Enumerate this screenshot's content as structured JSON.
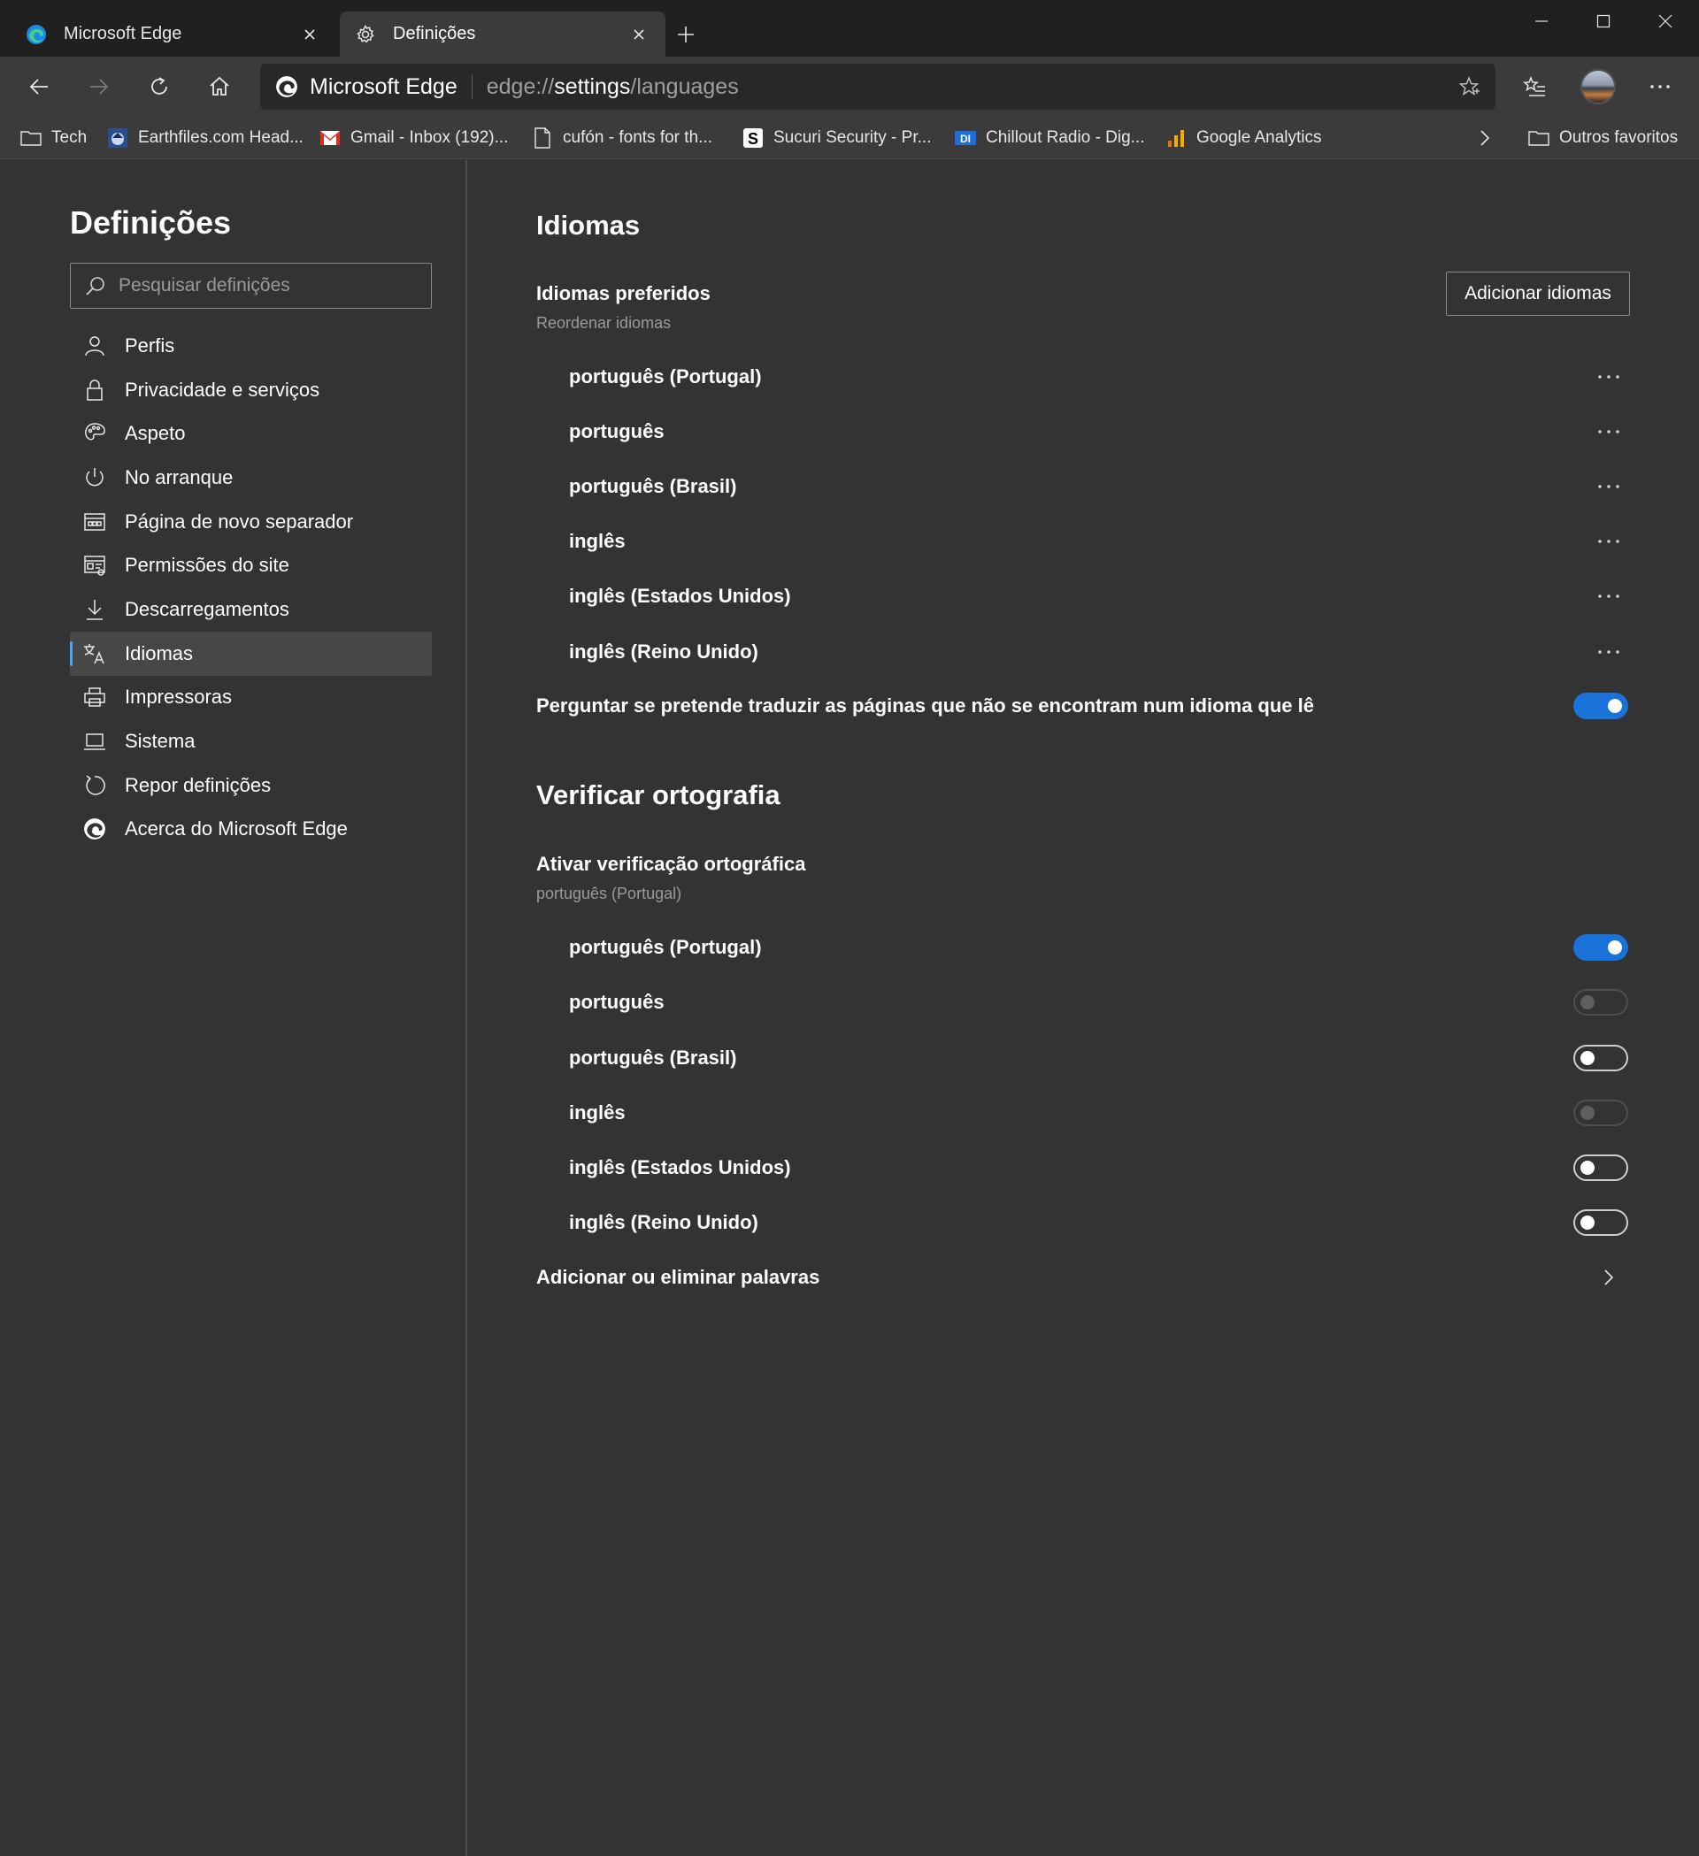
{
  "tabs": [
    {
      "label": "Microsoft Edge",
      "active": false
    },
    {
      "label": "Definições",
      "active": true
    }
  ],
  "address": {
    "site": "Microsoft Edge",
    "url_prefix": "edge://",
    "url_host": "settings",
    "url_path": "/languages"
  },
  "bookmarks": [
    {
      "label": "Tech",
      "icon": "folder-icon"
    },
    {
      "label": "Earthfiles.com Head...",
      "icon": "earthfiles-favicon"
    },
    {
      "label": "Gmail - Inbox (192)...",
      "icon": "gmail-favicon"
    },
    {
      "label": "cufón - fonts for th...",
      "icon": "page-icon"
    },
    {
      "label": "Sucuri Security - Pr...",
      "icon": "sucuri-favicon"
    },
    {
      "label": "Chillout Radio - Dig...",
      "icon": "di-favicon"
    },
    {
      "label": "Google Analytics",
      "icon": "analytics-favicon"
    },
    {
      "label": "Outros favoritos",
      "icon": "folder-icon"
    }
  ],
  "sidebar": {
    "title": "Definições",
    "search_placeholder": "Pesquisar definições",
    "items": [
      {
        "label": "Perfis",
        "icon": "person-icon"
      },
      {
        "label": "Privacidade e serviços",
        "icon": "lock-icon"
      },
      {
        "label": "Aspeto",
        "icon": "palette-icon"
      },
      {
        "label": "No arranque",
        "icon": "power-icon"
      },
      {
        "label": "Página de novo separador",
        "icon": "new-tab-page-icon"
      },
      {
        "label": "Permissões do site",
        "icon": "site-permissions-icon"
      },
      {
        "label": "Descarregamentos",
        "icon": "download-icon"
      },
      {
        "label": "Idiomas",
        "icon": "languages-icon",
        "selected": true
      },
      {
        "label": "Impressoras",
        "icon": "printer-icon"
      },
      {
        "label": "Sistema",
        "icon": "laptop-icon"
      },
      {
        "label": "Repor definições",
        "icon": "reset-icon"
      },
      {
        "label": "Acerca do Microsoft Edge",
        "icon": "edge-icon"
      }
    ]
  },
  "languages": {
    "title": "Idiomas",
    "preferred_title": "Idiomas preferidos",
    "preferred_sub": "Reordenar idiomas",
    "add_button": "Adicionar idiomas",
    "list": [
      "português (Portugal)",
      "português",
      "português (Brasil)",
      "inglês",
      "inglês (Estados Unidos)",
      "inglês (Reino Unido)"
    ],
    "translate_label": "Perguntar se pretende traduzir as páginas que não se encontram num idioma que lê",
    "translate_on": true
  },
  "spellcheck": {
    "title": "Verificar ortografia",
    "enable_title": "Ativar verificação ortográfica",
    "enable_sub": "português (Portugal)",
    "items": [
      {
        "label": "português (Portugal)",
        "state": "on"
      },
      {
        "label": "português",
        "state": "disabled"
      },
      {
        "label": "português (Brasil)",
        "state": "off"
      },
      {
        "label": "inglês",
        "state": "disabled"
      },
      {
        "label": "inglês (Estados Unidos)",
        "state": "off"
      },
      {
        "label": "inglês (Reino Unido)",
        "state": "off"
      }
    ],
    "add_words_label": "Adicionar ou eliminar palavras"
  },
  "colors": {
    "accent": "#1a73d9",
    "background": "#333333",
    "chrome": "#202020"
  }
}
